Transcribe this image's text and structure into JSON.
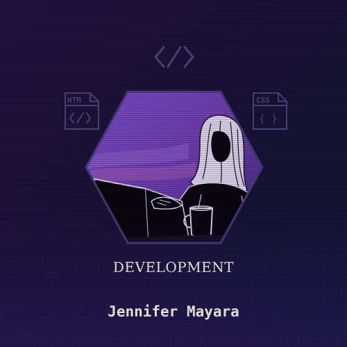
{
  "card": {
    "title": "DEVELOPMENT",
    "name": "Jennifer Mayara"
  },
  "icons": {
    "top": "code-brackets-icon",
    "left_file": "html-file-icon",
    "left_file_label": "HTM",
    "right_file": "css-file-icon",
    "right_file_label": "CSS"
  },
  "colors": {
    "background": "#1a1236",
    "hex_fill": "#6b3bb5",
    "hex_border": "#463a78",
    "icon_stroke": "#4b4480",
    "text": "#f4efe4"
  }
}
